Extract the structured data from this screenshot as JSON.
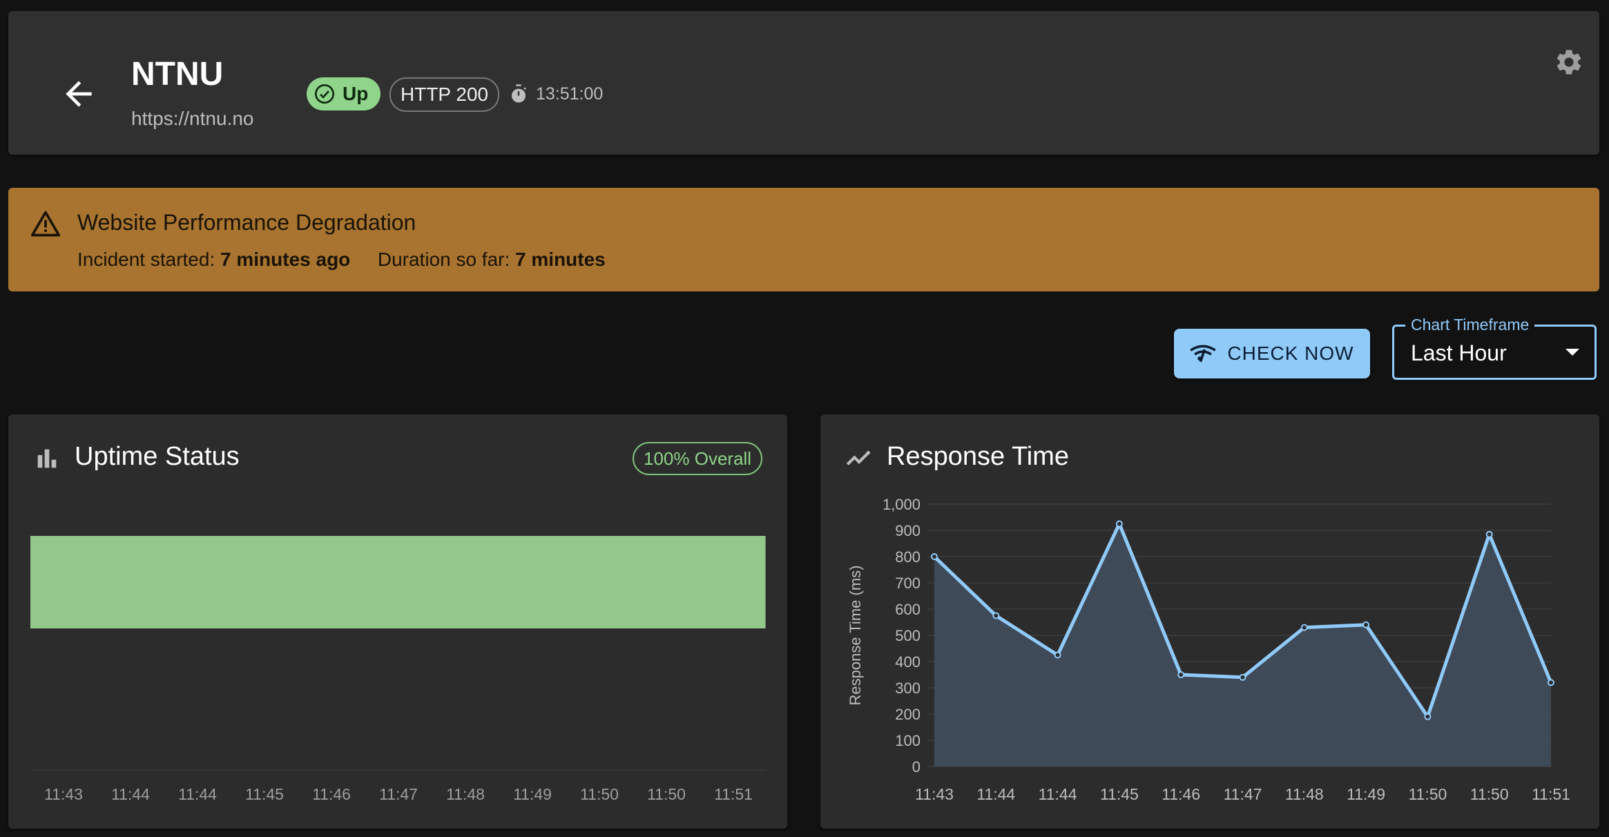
{
  "header": {
    "site_name": "NTNU",
    "site_url": "https://ntnu.no",
    "status": "Up",
    "http": "HTTP 200",
    "timer": "13:51:00"
  },
  "alert": {
    "title": "Website Performance Degradation",
    "started_label": "Incident started:",
    "started_value": "7 minutes ago",
    "duration_label": "Duration so far:",
    "duration_value": "7 minutes"
  },
  "controls": {
    "check_now": "CHECK NOW",
    "timeframe_label": "Chart Timeframe",
    "timeframe_value": "Last Hour"
  },
  "uptime": {
    "title": "Uptime Status",
    "overall": "100% Overall"
  },
  "response": {
    "title": "Response Time"
  },
  "colors": {
    "uptime_bar": "#94c78c",
    "line": "#90caf9",
    "accent": "#90caf9",
    "warning": "#a8742f"
  },
  "chart_data": [
    {
      "type": "bar",
      "title": "Uptime Status",
      "categories": [
        "11:43",
        "11:44",
        "11:44",
        "11:45",
        "11:46",
        "11:47",
        "11:48",
        "11:49",
        "11:50",
        "11:50",
        "11:51"
      ],
      "values": [
        1,
        1,
        1,
        1,
        1,
        1,
        1,
        1,
        1,
        1,
        1
      ],
      "ylim": [
        0,
        1.5
      ],
      "grid": false
    },
    {
      "type": "area",
      "title": "Response Time",
      "ylabel": "Response Time (ms)",
      "categories": [
        "11:43",
        "11:44",
        "11:44",
        "11:45",
        "11:46",
        "11:47",
        "11:48",
        "11:49",
        "11:50",
        "11:50",
        "11:51"
      ],
      "values": [
        800,
        575,
        425,
        925,
        350,
        340,
        530,
        540,
        190,
        885,
        320
      ],
      "ylim": [
        0,
        1000
      ],
      "yticks": [
        "0",
        "100",
        "200",
        "300",
        "400",
        "500",
        "600",
        "700",
        "800",
        "900",
        "1,000"
      ],
      "grid": true
    }
  ]
}
